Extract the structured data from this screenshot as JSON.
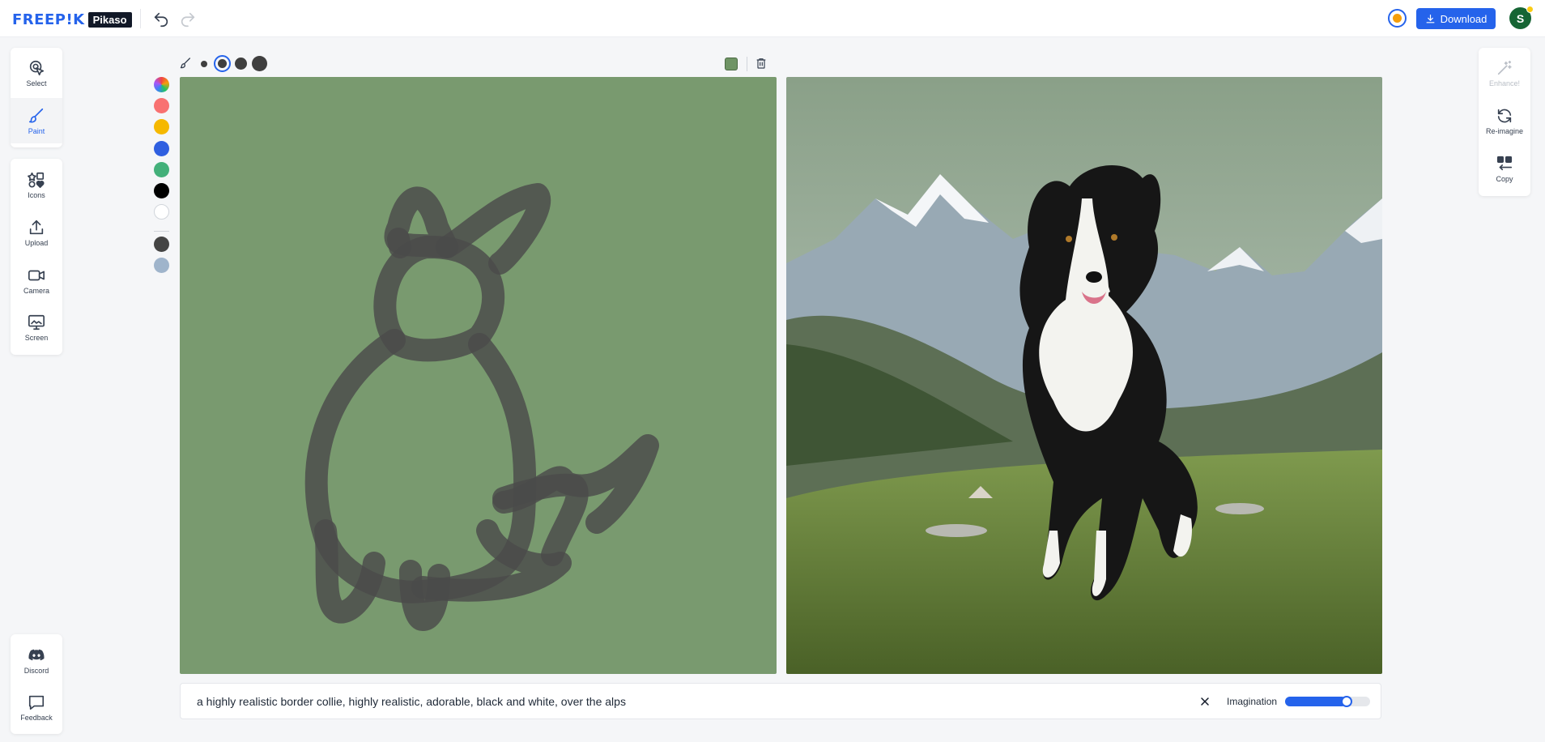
{
  "header": {
    "logo_text": "FREEP!K",
    "logo_badge": "Pikaso",
    "download_label": "Download",
    "avatar_initial": "S"
  },
  "tools_top": [
    {
      "label": "Select",
      "icon": "select-icon"
    },
    {
      "label": "Paint",
      "icon": "brush-icon"
    }
  ],
  "tools_mid": [
    {
      "label": "Icons",
      "icon": "shapes-icon"
    },
    {
      "label": "Upload",
      "icon": "upload-icon"
    },
    {
      "label": "Camera",
      "icon": "camera-icon"
    },
    {
      "label": "Screen",
      "icon": "screen-icon"
    }
  ],
  "tools_bottom": [
    {
      "label": "Discord",
      "icon": "discord-icon"
    },
    {
      "label": "Feedback",
      "icon": "chat-icon"
    }
  ],
  "tools_right": [
    {
      "label": "Enhance!",
      "icon": "magic-wand-icon",
      "disabled": true
    },
    {
      "label": "Re-imagine",
      "icon": "refresh-icon"
    },
    {
      "label": "Copy",
      "icon": "copy-icon"
    }
  ],
  "colors": {
    "accent": "#2563eb",
    "canvas_bg": "#799a6f",
    "stroke": "#4a4a4a",
    "swatches": [
      "rainbow",
      "#f87171",
      "#f5b800",
      "#2f5fe0",
      "#43b07a",
      "#000000",
      "#ffffff"
    ],
    "recent": [
      "#444444",
      "#9fb4cb"
    ],
    "active_color": "#6f9465"
  },
  "prompt": {
    "text": "a highly realistic border collie, highly realistic, adorable, black and white, over the alps",
    "imagination_label": "Imagination",
    "imagination_value": 0.72
  }
}
